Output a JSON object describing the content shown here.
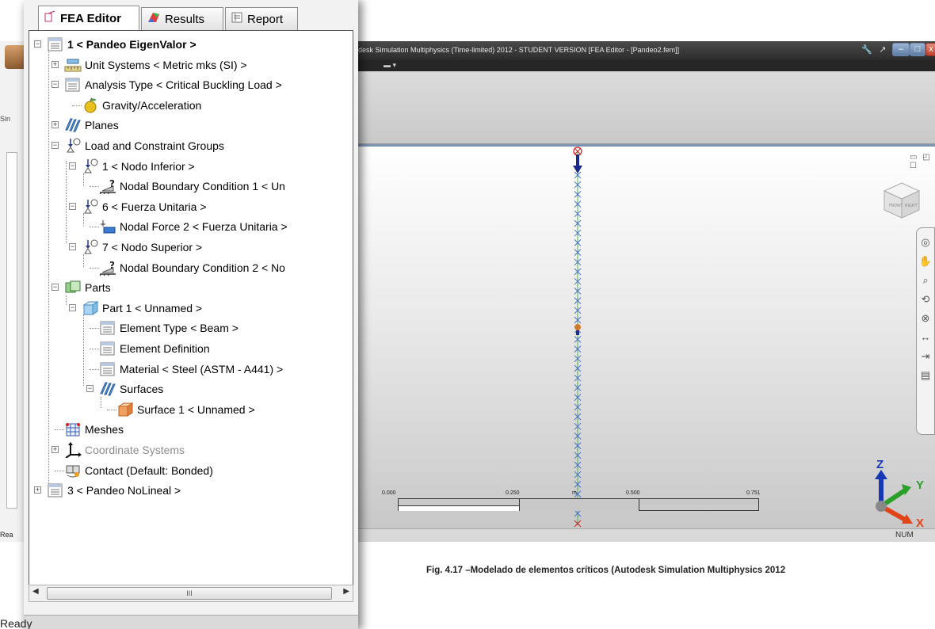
{
  "window": {
    "title": "desk Simulation Multiphysics (Time-limited) 2012 - STUDENT VERSION   [FEA Editor - [Pandeo2.fem]]",
    "status": "NUM",
    "left_label_sim": "Sin",
    "left_label_rea": "Rea"
  },
  "tabs": [
    {
      "label": "FEA Editor",
      "active": true,
      "icon": "fea-editor-icon"
    },
    {
      "label": "Results",
      "active": false,
      "icon": "results-icon"
    },
    {
      "label": "Report",
      "active": false,
      "icon": "report-icon"
    }
  ],
  "tree": [
    {
      "label": "1 < Pandeo EigenValor >",
      "icon": "analysis-doc-icon",
      "bold": true,
      "expander": "−"
    },
    {
      "label": "Unit Systems < Metric mks (SI) >",
      "icon": "ruler-icon",
      "expander": "+"
    },
    {
      "label": "Analysis Type < Critical Buckling Load >",
      "icon": "analysis-doc-icon",
      "expander": "−"
    },
    {
      "label": "Gravity/Acceleration",
      "icon": "apple-icon"
    },
    {
      "label": "Planes",
      "icon": "planes-icon",
      "expander": "+"
    },
    {
      "label": "Load and Constraint Groups",
      "icon": "load-group-icon",
      "expander": "−"
    },
    {
      "label": "1 < Nodo Inferior >",
      "icon": "load-group-icon",
      "expander": "−"
    },
    {
      "label": "Nodal Boundary Condition 1 < Un",
      "icon": "boundary-condition-icon"
    },
    {
      "label": "6 < Fuerza Unitaria >",
      "icon": "load-group-icon",
      "expander": "−"
    },
    {
      "label": "Nodal Force 2 < Fuerza Unitaria >",
      "icon": "nodal-force-icon"
    },
    {
      "label": "7 < Nodo Superior >",
      "icon": "load-group-icon",
      "expander": "−"
    },
    {
      "label": "Nodal Boundary Condition 2 < No",
      "icon": "boundary-condition-icon"
    },
    {
      "label": "Parts",
      "icon": "parts-icon",
      "expander": "−"
    },
    {
      "label": "Part 1 < Unnamed >",
      "icon": "part-cube-icon",
      "expander": "−"
    },
    {
      "label": "Element Type < Beam >",
      "icon": "analysis-doc-icon"
    },
    {
      "label": "Element Definition",
      "icon": "analysis-doc-icon"
    },
    {
      "label": "Material < Steel (ASTM - A441) >",
      "icon": "analysis-doc-icon"
    },
    {
      "label": "Surfaces",
      "icon": "planes-icon",
      "expander": "−"
    },
    {
      "label": "Surface 1 < Unnamed >",
      "icon": "surface-icon"
    },
    {
      "label": "Meshes",
      "icon": "mesh-icon"
    },
    {
      "label": "Coordinate Systems",
      "icon": "coordinate-axes-icon",
      "expander": "+",
      "gray": true
    },
    {
      "label": "Contact (Default: Bonded)",
      "icon": "contact-icon"
    },
    {
      "label": "3 < Pandeo NoLineal >",
      "icon": "analysis-doc-icon",
      "expander": "+"
    }
  ],
  "scrollbar": {
    "thumb_glyph": "III"
  },
  "status_bar": {
    "text": "Ready"
  },
  "scale": {
    "labels": [
      "0.000",
      "0.250",
      "m",
      "0.500",
      "0.751"
    ]
  },
  "triad": {
    "z": "Z",
    "y": "Y",
    "x": "X"
  },
  "caption": "Fig. 4.17 –Modelado de elementos críticos  (Autodesk Simulation Multiphysics 2012"
}
